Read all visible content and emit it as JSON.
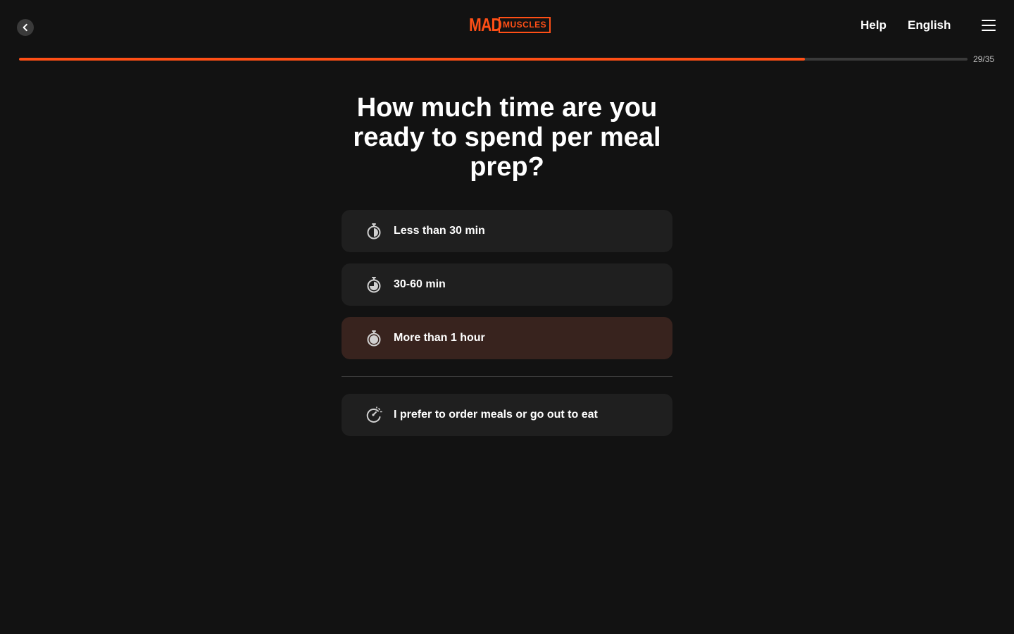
{
  "header": {
    "back_icon": "chevron-left-icon",
    "logo_primary": "MAD",
    "logo_secondary": "MUSCLES",
    "help_label": "Help",
    "language_label": "English",
    "menu_icon": "hamburger-menu-icon"
  },
  "progress": {
    "current": 29,
    "total": 35,
    "label": "29/35",
    "fraction": 0.8286
  },
  "colors": {
    "accent": "#ff4f16",
    "background": "#121212",
    "option_bg": "#1f1f1f",
    "option_selected_bg": "#38231e"
  },
  "question": {
    "title": "How much time are you ready to spend per meal prep?"
  },
  "options": [
    {
      "label": "Less than 30 min",
      "icon": "stopwatch-half-icon",
      "selected": false
    },
    {
      "label": "30-60 min",
      "icon": "stopwatch-three-quarter-icon",
      "selected": false
    },
    {
      "label": "More than 1 hour",
      "icon": "stopwatch-full-icon",
      "selected": true
    }
  ],
  "alternative_option": {
    "label": "I prefer to order meals or go out to eat",
    "icon": "delivery-clock-icon",
    "selected": false
  }
}
